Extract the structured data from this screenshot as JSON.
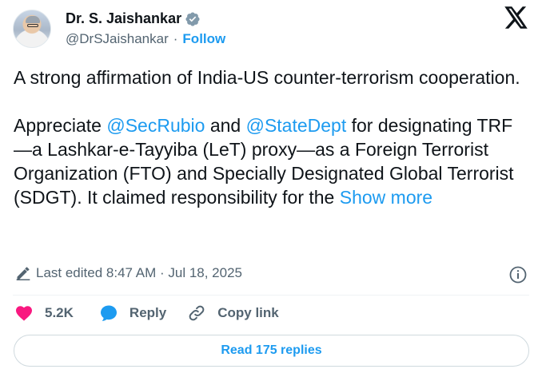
{
  "author": {
    "name": "Dr. S. Jaishankar",
    "handle": "@DrSJaishankar",
    "separator": "·",
    "follow_label": "Follow"
  },
  "tweet": {
    "line1": "A strong affirmation of India-US counter-terrorism cooperation.",
    "para2_prefix": "Appreciate ",
    "mention1": "@SecRubio",
    "para2_mid": " and ",
    "mention2": "@StateDept",
    "para2_rest": " for designating TRF—a Lashkar-e-Tayyiba (LeT) proxy—as a Foreign Terrorist Organization (FTO) and Specially Designated Global Terrorist (SDGT). It claimed responsibility for the ",
    "show_more_label": "Show more"
  },
  "meta": {
    "edited_text": "Last edited 8:47 AM · Jul 18, 2025"
  },
  "actions": {
    "likes_count": "5.2K",
    "reply_label": "Reply",
    "copy_link_label": "Copy link"
  },
  "read_replies_label": "Read 175 replies",
  "colors": {
    "accent": "#1d9bf0",
    "like": "#f91880",
    "muted": "#536471",
    "text": "#0f1419"
  },
  "icons": [
    "verified-badge-icon",
    "x-logo-icon",
    "pencil-icon",
    "info-icon",
    "heart-icon",
    "reply-bubble-icon",
    "link-icon"
  ]
}
